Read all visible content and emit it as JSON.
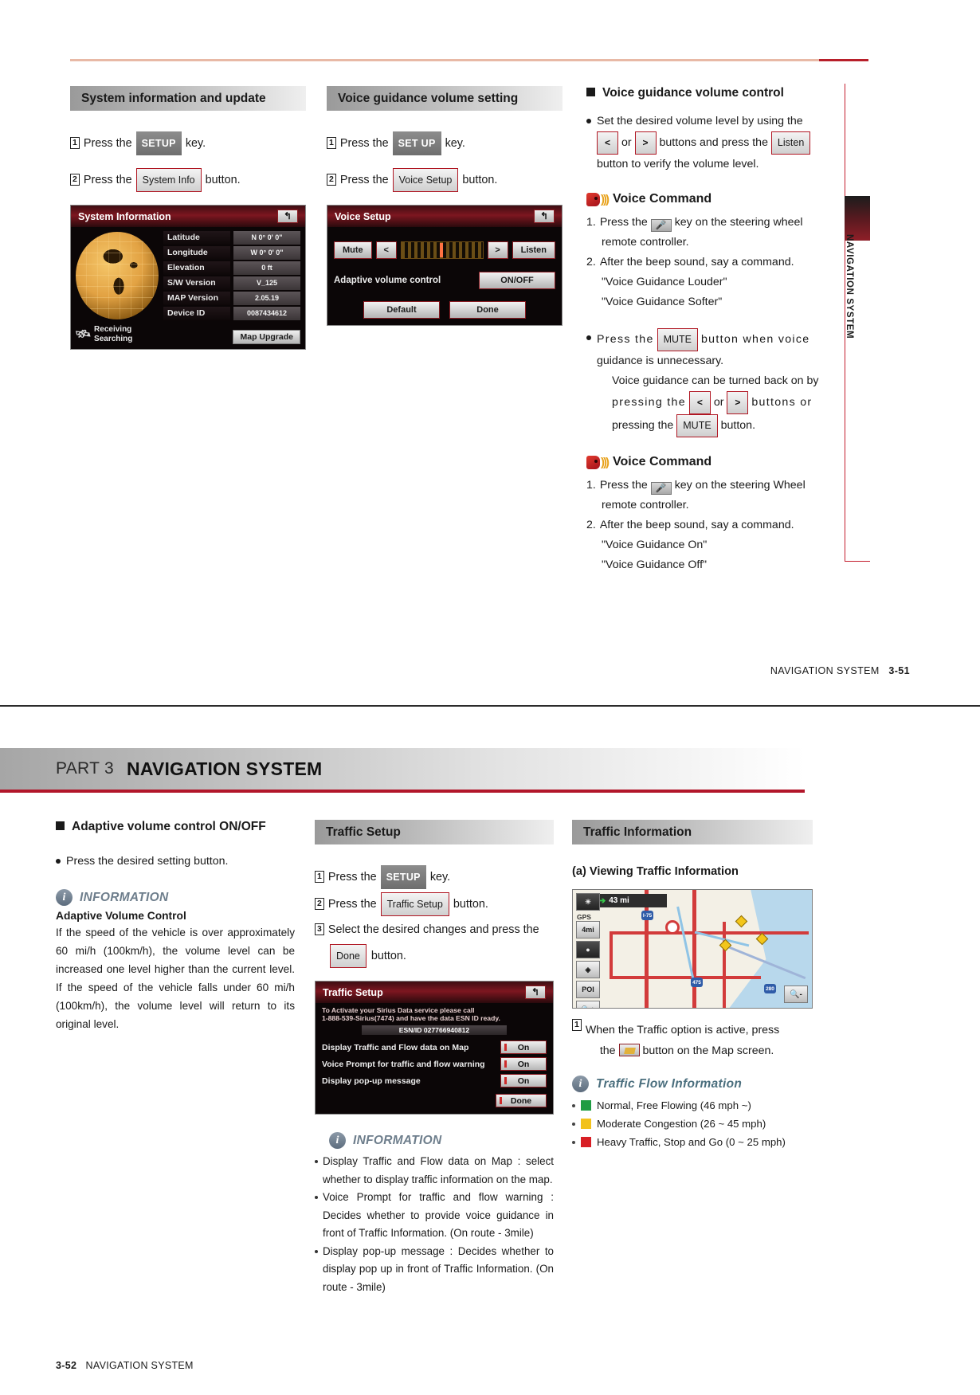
{
  "page1": {
    "side_tab_label": "NAVIGATION SYSTEM",
    "footer": {
      "label": "NAVIGATION SYSTEM",
      "page": "3-51"
    },
    "col_a": {
      "heading": "System information and update",
      "step1": {
        "num": "1",
        "pre": "Press the",
        "key": "SETUP",
        "post": "key."
      },
      "step2": {
        "num": "2",
        "pre": "Press the",
        "key": "System Info",
        "post": "button."
      },
      "screenshot": {
        "title": "System Information",
        "back_icon": "↰",
        "rows": [
          {
            "label": "Latitude",
            "value": "N  0° 0' 0\""
          },
          {
            "label": "Longitude",
            "value": "W  0° 0' 0\""
          },
          {
            "label": "Elevation",
            "value": "0 ft"
          },
          {
            "label": "S/W Version",
            "value": "V_125"
          },
          {
            "label": "MAP Version",
            "value": "2.05.19"
          },
          {
            "label": "Device ID",
            "value": "0087434612"
          }
        ],
        "status_line1": "Receiving",
        "status_line2": "Searching",
        "map_upgrade_button": "Map Upgrade"
      }
    },
    "col_b": {
      "heading": "Voice guidance volume setting",
      "step1": {
        "num": "1",
        "pre": "Press the",
        "key": "SET UP",
        "post": "key."
      },
      "step2": {
        "num": "2",
        "pre": "Press the",
        "key": "Voice Setup",
        "post": "button."
      },
      "screenshot": {
        "title": "Voice Setup",
        "back_icon": "↰",
        "mute_button": "Mute",
        "left_button": "<",
        "right_button": ">",
        "listen_button": "Listen",
        "adaptive_label": "Adaptive volume control",
        "onoff_button": "ON/OFF",
        "default_button": "Default",
        "done_button": "Done"
      }
    },
    "col_c": {
      "heading": "Voice guidance volume control",
      "bullet1": {
        "part1": "Set the desired volume level by using the",
        "key_left": "<",
        "or": "or",
        "key_right": ">",
        "part2": "buttons and press the",
        "key_listen": "Listen",
        "part3": "button to verify the volume level."
      },
      "voice_command_1": {
        "title": "Voice Command",
        "item1_num": "1.",
        "item1_a": "Press the",
        "item1_key": "voice-key",
        "item1_b": "key on the steering wheel",
        "item1_c": "remote controller.",
        "item2_num": "2.",
        "item2": "After the beep sound, say a command.",
        "quote1": "\"Voice Guidance Louder\"",
        "quote2": "\"Voice Guidance Softer\""
      },
      "bullet2": {
        "part1": "Press the",
        "key_mute": "MUTE",
        "part2": "button when voice",
        "part3": "guidance is unnecessary.",
        "part4": "Voice guidance can be turned back on by",
        "part5": "pressing the",
        "key_left": "<",
        "or": "or",
        "key_right": ">",
        "part6": "buttons or",
        "part7": "pressing the",
        "key_mute2": "MUTE",
        "part8": "button."
      },
      "voice_command_2": {
        "title": "Voice Command",
        "item1_num": "1.",
        "item1_a": "Press the",
        "item1_key": "voice-key",
        "item1_b": "key on the steering Wheel",
        "item1_c": "remote controller.",
        "item2_num": "2.",
        "item2": "After the beep sound, say a command.",
        "quote1": "\"Voice Guidance On\"",
        "quote2": "\"Voice Guidance Off\""
      }
    }
  },
  "page2": {
    "part_label": "PART 3",
    "part_title": "NAVIGATION SYSTEM",
    "footer": {
      "page": "3-52",
      "label": "NAVIGATION SYSTEM"
    },
    "col_a": {
      "heading": "Adaptive volume control ON/OFF",
      "bullet": "Press the desired setting button.",
      "info_title": "INFORMATION",
      "info_sub": "Adaptive Volume Control",
      "info_body": "If the speed of the vehicle is over approximately 60 mi/h (100km/h), the volume level can be increased one level higher than the current level. If the speed of the vehicle falls under 60 mi/h (100km/h), the volume level will return to its original level."
    },
    "col_b": {
      "heading": "Traffic Setup",
      "step1": {
        "num": "1",
        "pre": "Press the",
        "key": "SETUP",
        "post": "key."
      },
      "step2": {
        "num": "2",
        "pre": "Press the",
        "key": "Traffic Setup",
        "post": "button."
      },
      "step3": {
        "num": "3",
        "pre": "Select the desired changes and press the",
        "key": "Done",
        "post": "button."
      },
      "screenshot": {
        "title": "Traffic Setup",
        "back_icon": "↰",
        "note_line1": "To Activate your Sirius Data service please call",
        "note_line2": "1-888-539-Sirius(7474) and have the data ESN ID ready.",
        "esn": "ESN/ID  027766940812",
        "rows": [
          {
            "label": "Display Traffic and Flow data on Map",
            "value": "On"
          },
          {
            "label": "Voice Prompt for traffic and flow warning",
            "value": "On"
          },
          {
            "label": "Display  pop-up message",
            "value": "On"
          }
        ],
        "done_button": "Done"
      },
      "info_title": "INFORMATION",
      "info_items": [
        "Display Traffic and Flow data on Map : select whether to display traffic information on the map.",
        "Voice Prompt for traffic and flow warning : Decides whether to provide voice guidance in front of Traffic Information. (On route - 3mile)",
        "Display pop-up message : Decides whether to display pop up in front of Traffic Information. (On route - 3mile)"
      ]
    },
    "col_c": {
      "heading": "Traffic Information",
      "sub_a": "(a) Viewing Traffic Information",
      "map": {
        "distance": "43 mi",
        "gps_label": "GPS",
        "scale_label": "4mi",
        "poi_label": "POI",
        "zoom_in_label": "+",
        "zoom_out_label": "-",
        "shield1": "I-75",
        "shield2": "475",
        "shield3": "280"
      },
      "step1": {
        "num": "1",
        "text_a": "When the Traffic option is active, press",
        "text_b": "the",
        "icon": "traffic-icon",
        "text_c": "button on the Map screen."
      },
      "info_title": "Traffic Flow Information",
      "legend": [
        {
          "color": "#1f9c42",
          "text": "Normal, Free Flowing (46 mph ~)"
        },
        {
          "color": "#f2c21c",
          "text": "Moderate Congestion (26 ~ 45 mph)"
        },
        {
          "color": "#d81f25",
          "text": "Heavy Traffic, Stop and Go (0 ~ 25 mph)"
        }
      ]
    }
  }
}
